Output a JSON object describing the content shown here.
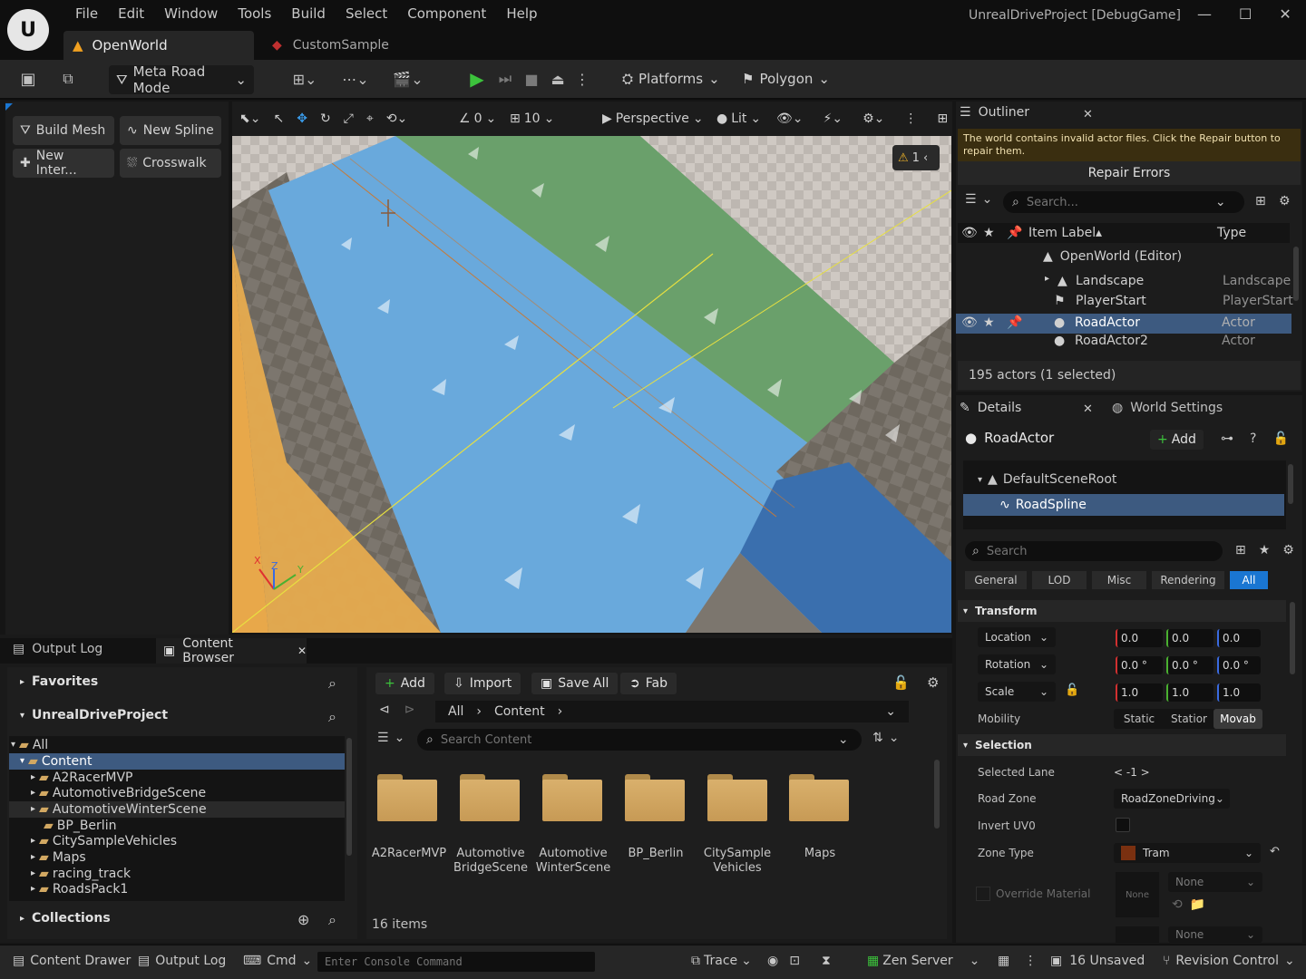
{
  "app": {
    "menu": [
      "File",
      "Edit",
      "Window",
      "Tools",
      "Build",
      "Select",
      "Component",
      "Help"
    ],
    "project_title": "UnrealDriveProject [DebugGame]",
    "tabs": [
      {
        "label": "OpenWorld"
      },
      {
        "label": "CustomSample"
      }
    ]
  },
  "toolbar": {
    "mode_label": "Meta Road Mode",
    "platforms_label": "Platforms",
    "polygon_label": "Polygon"
  },
  "modes_panel": {
    "buttons": [
      "Build Mesh",
      "New Spline",
      "New Inter...",
      "Crosswalk"
    ]
  },
  "viewport": {
    "snap_rotation": "0",
    "snap_grid": "10",
    "perspective_label": "Perspective",
    "lit_label": "Lit",
    "warning_count": "1",
    "axis_labels": {
      "x": "X",
      "z": "Z",
      "y": "Y"
    }
  },
  "outliner": {
    "tab_label": "Outliner",
    "warning_text": "The world contains invalid actor files. Click the Repair button to repair them.",
    "repair_label": "Repair Errors",
    "search_placeholder": "Search...",
    "col_label": "Item Label",
    "col_type": "Type",
    "root": "OpenWorld (Editor)",
    "rows": [
      {
        "label": "Landscape",
        "type": "Landscape"
      },
      {
        "label": "PlayerStart",
        "type": "PlayerStart"
      },
      {
        "label": "RoadActor",
        "type": "Actor"
      },
      {
        "label": "RoadActor2",
        "type": "Actor"
      }
    ],
    "status": "195 actors (1 selected)"
  },
  "details": {
    "tab_label": "Details",
    "world_settings_label": "World Settings",
    "actor_name": "RoadActor",
    "add_label": "Add",
    "components": [
      "DefaultSceneRoot",
      "RoadSpline"
    ],
    "search_placeholder": "Search",
    "filters": [
      "General",
      "LOD",
      "Misc",
      "Rendering",
      "All"
    ],
    "transform_label": "Transform",
    "location": {
      "label": "Location",
      "x": "0.0",
      "y": "0.0",
      "z": "0.0"
    },
    "rotation": {
      "label": "Rotation",
      "x": "0.0 °",
      "y": "0.0 °",
      "z": "0.0 °"
    },
    "scale": {
      "label": "Scale",
      "x": "1.0",
      "y": "1.0",
      "z": "1.0"
    },
    "mobility_label": "Mobility",
    "mobility_options": [
      "Static",
      "Statior",
      "Movab"
    ],
    "selection_label": "Selection",
    "selected_lane_label": "Selected Lane",
    "selected_lane_value": "< -1 >",
    "road_zone_label": "Road Zone",
    "road_zone_value": "RoadZoneDriving",
    "invert_uv_label": "Invert UV0",
    "zone_type_label": "Zone Type",
    "zone_type_value": "Tram",
    "override_material_label": "Override Material",
    "none_label": "None"
  },
  "content_browser": {
    "output_log_tab": "Output Log",
    "tab_label": "Content Browser",
    "favorites_label": "Favorites",
    "project_label": "UnrealDriveProject",
    "tree": [
      "All",
      "Content",
      "A2RacerMVP",
      "AutomotiveBridgeScene",
      "AutomotiveWinterScene",
      "BP_Berlin",
      "CitySampleVehicles",
      "Maps",
      "racing_track",
      "RoadsPack1"
    ],
    "collections_label": "Collections",
    "add_label": "Add",
    "import_label": "Import",
    "save_all_label": "Save All",
    "fab_label": "Fab",
    "breadcrumb": [
      "All",
      "Content"
    ],
    "search_placeholder": "Search Content",
    "assets": [
      {
        "line1": "A2RacerMVP",
        "line2": ""
      },
      {
        "line1": "Automotive",
        "line2": "BridgeScene"
      },
      {
        "line1": "Automotive",
        "line2": "WinterScene"
      },
      {
        "line1": "BP_Berlin",
        "line2": ""
      },
      {
        "line1": "CitySample",
        "line2": "Vehicles"
      },
      {
        "line1": "Maps",
        "line2": ""
      }
    ],
    "item_count": "16 items"
  },
  "statusbar": {
    "content_drawer": "Content Drawer",
    "output_log": "Output Log",
    "cmd": "Cmd",
    "console_placeholder": "Enter Console Command",
    "trace": "Trace",
    "zen_server": "Zen Server",
    "unsaved": "16 Unsaved",
    "revision_control": "Revision Control"
  },
  "colors": {
    "accent": "#1a76d2",
    "selected_row": "#3d5a80",
    "folder": "#d2a862",
    "warning": "#f0b428"
  }
}
